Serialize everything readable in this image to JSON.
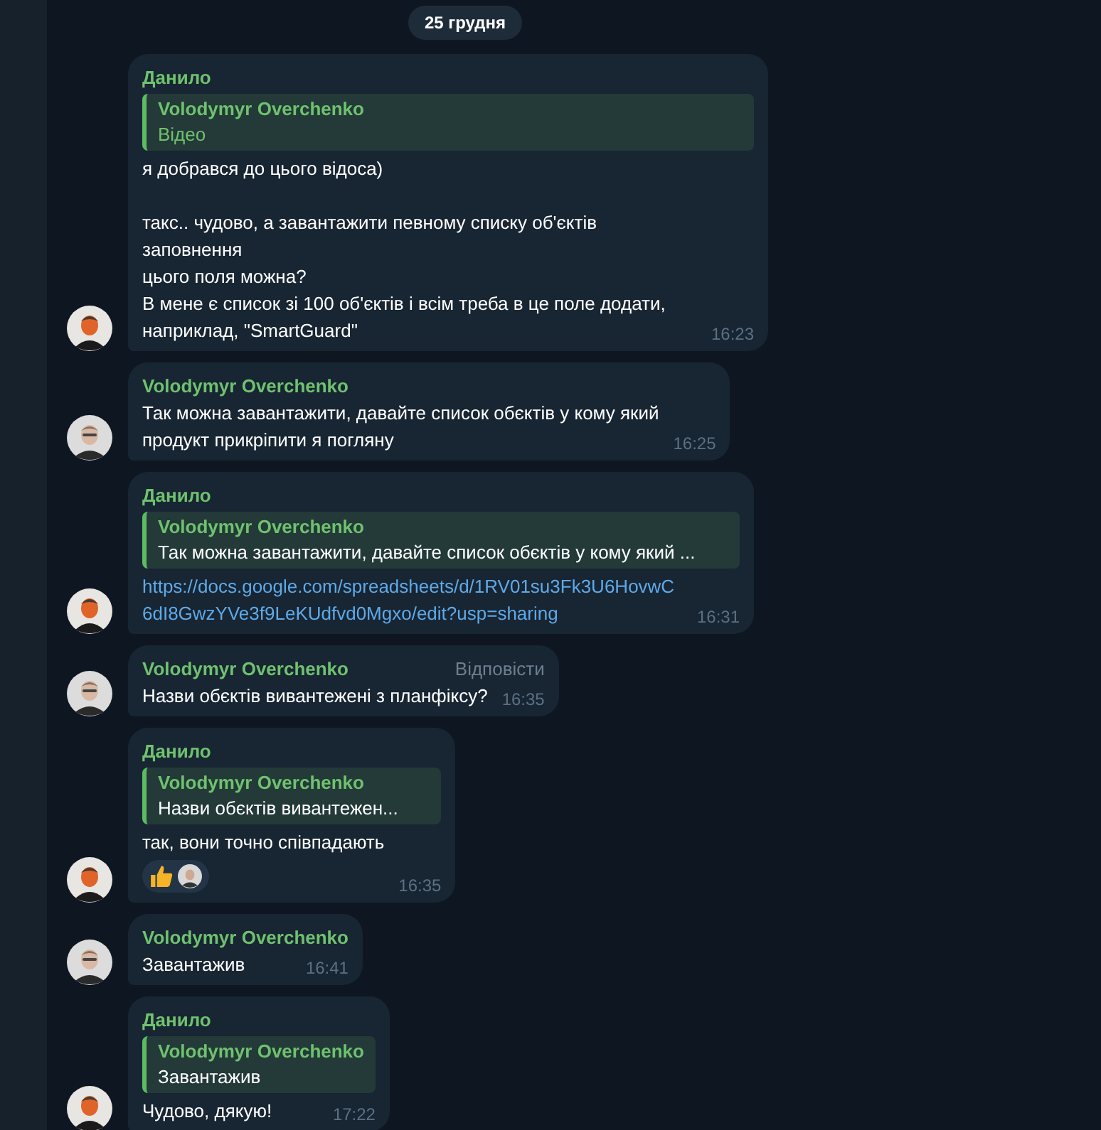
{
  "date_pill": "25 грудня",
  "messages": [
    {
      "author": "Данило",
      "avatar": {
        "kind": "orange"
      },
      "reply": {
        "author": "Volodymyr Overchenko",
        "text": "Відео"
      },
      "text": "я добрався до цього відоса)\n\nтакс.. чудово, а завантажити певному списку об'єктів заповнення\nцього поля можна?\nВ мене є список зі 100 об'єктів і всім треба в це поле додати,\nнаприклад, \"SmartGuard\"",
      "time": "16:23"
    },
    {
      "author": "Volodymyr Overchenko",
      "avatar": {
        "kind": "light"
      },
      "text": "Так можна завантажити, давайте список обєктів у кому який\nпродукт прикріпити я погляну",
      "time": "16:25"
    },
    {
      "author": "Данило",
      "avatar": {
        "kind": "orange"
      },
      "reply": {
        "author": "Volodymyr Overchenko",
        "text": "Так можна завантажити, давайте список обєктів у кому який ..."
      },
      "link": "https://docs.google.com/spreadsheets/d/1RV01su3Fk3U6HovwC6dI8GwzYVe3f9LeKUdfvd0Mgxo/edit?usp=sharing",
      "time": "16:31"
    },
    {
      "author": "Volodymyr Overchenko",
      "avatar": {
        "kind": "light"
      },
      "action": "Відповісти",
      "text": "Назви обєктів вивантежені з планфіксу?",
      "time": "16:35"
    },
    {
      "author": "Данило",
      "avatar": {
        "kind": "orange"
      },
      "reply": {
        "author": "Volodymyr Overchenko",
        "text": "Назви обєктів вивантежен..."
      },
      "text": "так, вони точно співпадають",
      "reactions": [
        {
          "kind": "thumbs-up"
        },
        {
          "kind": "avatar"
        }
      ],
      "time": "16:35"
    },
    {
      "author": "Volodymyr Overchenko",
      "avatar": {
        "kind": "light"
      },
      "text": "Завантажив",
      "time": "16:41"
    },
    {
      "author": "Данило",
      "avatar": {
        "kind": "orange"
      },
      "reply": {
        "author": "Volodymyr Overchenko",
        "text": "Завантажив"
      },
      "text": "Чудово, дякую!",
      "time": "17:22"
    }
  ]
}
